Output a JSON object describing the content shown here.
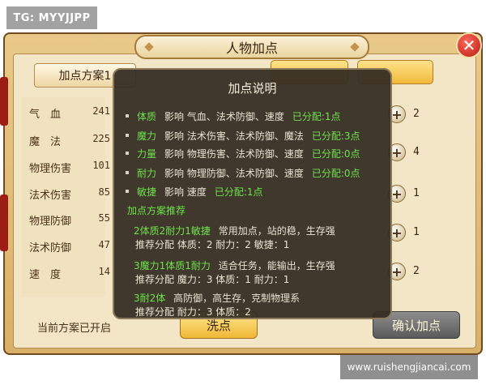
{
  "window": {
    "title": "人物加点"
  },
  "left_panel": {
    "scheme_button": "加点方案1",
    "stats": [
      {
        "label": "气　血",
        "value": "241"
      },
      {
        "label": "魔　法",
        "value": "225"
      },
      {
        "label": "物理伤害",
        "value": "101"
      },
      {
        "label": "法术伤害",
        "value": "85"
      },
      {
        "label": "物理防御",
        "value": "55"
      },
      {
        "label": "法术防御",
        "value": "47"
      },
      {
        "label": "速　度",
        "value": "14"
      }
    ],
    "status_text": "当前方案已开启"
  },
  "right_panel": {
    "allocations": [
      "2",
      "4",
      "1",
      "1",
      "2"
    ],
    "plus_symbol": "+"
  },
  "bottom_buttons": {
    "wash": "洗点",
    "confirm": "确认加点"
  },
  "popup": {
    "title": "加点说明",
    "attributes": [
      {
        "name": "体质",
        "effect": "影响 气血、法术防御、速度",
        "allocated": "已分配:1点"
      },
      {
        "name": "魔力",
        "effect": "影响 法术伤害、法术防御、魔法",
        "allocated": "已分配:3点"
      },
      {
        "name": "力量",
        "effect": "影响 物理伤害、法术防御、速度",
        "allocated": "已分配:0点"
      },
      {
        "name": "耐力",
        "effect": "影响 物理防御、法术防御、速度",
        "allocated": "已分配:0点"
      },
      {
        "name": "敏捷",
        "effect": "影响 速度",
        "allocated": "已分配:1点"
      }
    ],
    "recommend_header": "加点方案推荐",
    "recommendations": [
      {
        "name": "2体质2耐力1敏捷",
        "desc": "常用加点，站的稳，生存强",
        "distribution": "推荐分配 体质：2 耐力：2 敏捷：1"
      },
      {
        "name": "3魔力1体质1耐力",
        "desc": "适合任务，能输出，生存强",
        "distribution": "推荐分配 魔力：3 体质：1 耐力：1"
      },
      {
        "name": "3耐2体",
        "desc": "高防御，高生存，克制物理系",
        "distribution": "推荐分配 耐力：3 体质：2"
      }
    ]
  },
  "watermarks": {
    "top_left": "TG: MYYJJPP",
    "bottom_right": "www.ruishengjiancai.com"
  },
  "icons": {
    "close": "close-icon",
    "plus": "plus-icon"
  },
  "colors": {
    "highlight_green": "#6ee14b",
    "popup_bg": "#342d23",
    "button_gold": "#f1b93a",
    "close_red": "#b51a12"
  }
}
